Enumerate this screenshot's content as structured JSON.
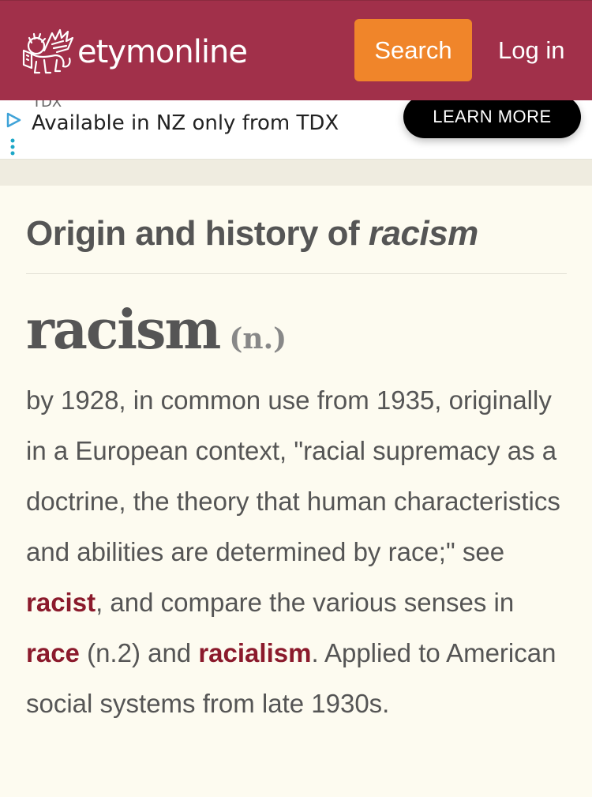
{
  "header": {
    "brand": "etymonline",
    "search_label": "Search",
    "login_label": "Log in",
    "brand_color": "#a1304a",
    "search_color": "#f0852a"
  },
  "ad": {
    "advertiser": "TDX",
    "text": "Available in NZ only from TDX",
    "cta_label": "LEARN MORE",
    "icons": [
      "adchoices-play-icon",
      "more-options-icon"
    ]
  },
  "entry": {
    "title_prefix": "Origin and history of ",
    "title_term": "racism",
    "headword": "racism",
    "part_of_speech": "(n.)",
    "definition": {
      "part1": "by 1928, in common use from 1935, originally in a European context, \"racial supremacy as a doctrine, the theory that human characteristics and abilities are determined by race;\" see ",
      "link1": "racist",
      "part2": ", and compare the various senses in ",
      "link2": "race",
      "part3": " (n.2) and ",
      "link3": "racialism",
      "part4": ". Applied to American social systems from late 1930s."
    },
    "link_color": "#8b1a2c"
  }
}
